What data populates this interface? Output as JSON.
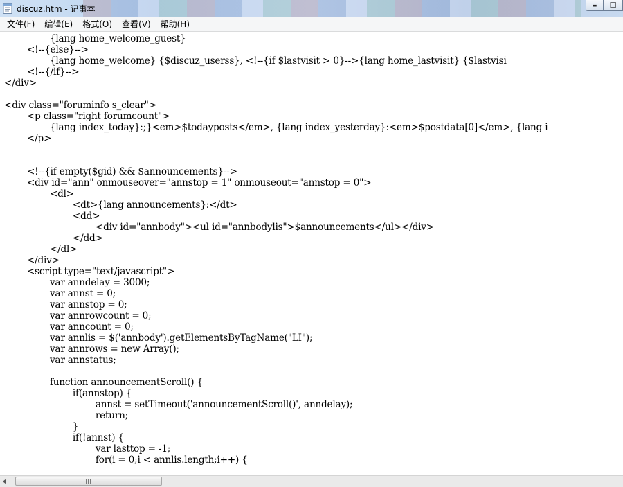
{
  "window": {
    "title": "discuz.htm - 记事本",
    "minimize_glyph": "▬",
    "maximize_glyph": "☐"
  },
  "menu": [
    {
      "label": "文件(F)"
    },
    {
      "label": "编辑(E)"
    },
    {
      "label": "格式(O)"
    },
    {
      "label": "查看(V)"
    },
    {
      "label": "帮助(H)"
    }
  ],
  "editor": {
    "content": "\t\t{lang home_welcome_guest}\n\t<!--{else}-->\n\t\t{lang home_welcome} {$discuz_userss}, <!--{if $lastvisit > 0}-->{lang home_lastvisit} {$lastvisi\n\t<!--{/if}-->\n</div>\n\n<div class=\"foruminfo s_clear\">\n\t<p class=\"right forumcount\">\n\t\t{lang index_today}:;}<em>$todayposts</em>, {lang index_yesterday}:<em>$postdata[0]</em>, {lang i\n\t</p>\n\n\n\t<!--{if empty($gid) && $announcements}-->\n\t<div id=\"ann\" onmouseover=\"annstop = 1\" onmouseout=\"annstop = 0\">\n\t\t<dl>\n\t\t\t<dt>{lang announcements}:</dt>\n\t\t\t<dd>\n\t\t\t\t<div id=\"annbody\"><ul id=\"annbodylis\">$announcements</ul></div>\n\t\t\t</dd>\n\t\t</dl>\n\t</div>\n\t<script type=\"text/javascript\">\n\t\tvar anndelay = 3000;\n\t\tvar annst = 0;\n\t\tvar annstop = 0;\n\t\tvar annrowcount = 0;\n\t\tvar anncount = 0;\n\t\tvar annlis = $('annbody').getElementsByTagName(\"LI\");\n\t\tvar annrows = new Array();\n\t\tvar annstatus;\n\n\t\tfunction announcementScroll() {\n\t\t\tif(annstop) {\n\t\t\t\tannst = setTimeout('announcementScroll()', anndelay);\n\t\t\t\treturn;\n\t\t\t}\n\t\t\tif(!annst) {\n\t\t\t\tvar lasttop = -1;\n\t\t\t\tfor(i = 0;i < annlis.length;i++) {"
  },
  "colors": {
    "titlebar": "#c9dcf3",
    "menubar": "#f5f6f7",
    "editor_bg": "#ffffff",
    "text": "#000000"
  },
  "icons": [
    "notepad-icon",
    "minimize-icon",
    "maximize-icon",
    "scroll-left-arrow-icon",
    "scroll-grip-icon"
  ]
}
